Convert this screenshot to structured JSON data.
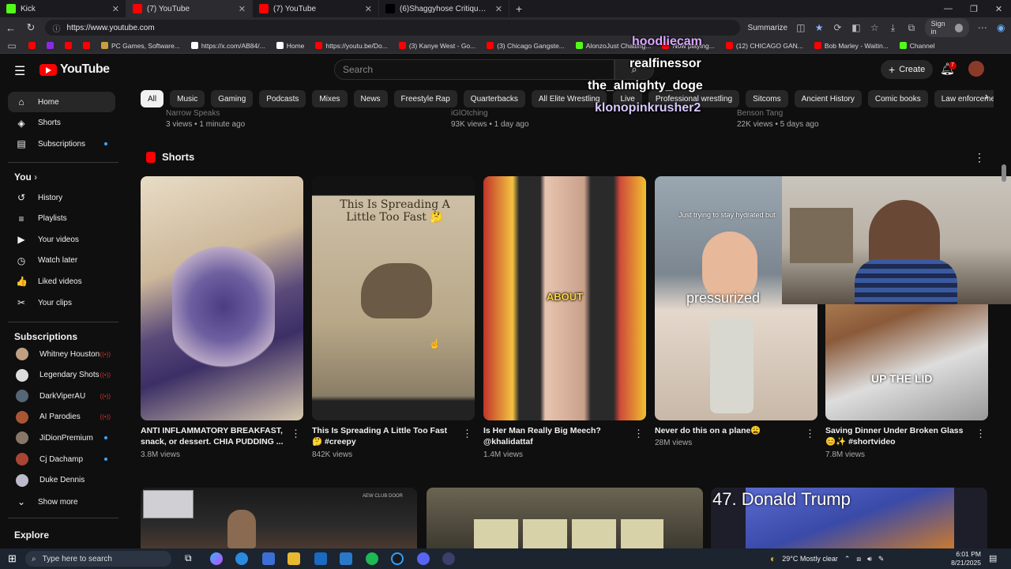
{
  "browser": {
    "tabs": [
      {
        "title": "Kick",
        "icon_color": "#53fc18",
        "active": false
      },
      {
        "title": "(7) YouTube",
        "icon_color": "#ff0000",
        "active": true
      },
      {
        "title": "(7) YouTube",
        "icon_color": "#ff0000",
        "active": false
      },
      {
        "title": "(6)Shaggyhose Critiques Kai Cenat",
        "icon_color": "#000000",
        "active": false
      }
    ],
    "new_tab": "+",
    "url": "https://www.youtube.com",
    "summarize": "Summarize",
    "sign_in": "Sign in",
    "bookmarks": [
      {
        "label": "",
        "color": "#ff0000"
      },
      {
        "label": "",
        "color": "#8a2be2"
      },
      {
        "label": "",
        "color": "#ff0000"
      },
      {
        "label": "",
        "color": "#ff0000"
      },
      {
        "label": "PC Games, Software...",
        "color": "#c8a040"
      },
      {
        "label": "https://x.com/AB84/...",
        "color": "#ffffff"
      },
      {
        "label": "Home",
        "color": "#ffffff"
      },
      {
        "label": "https://youtu.be/Do...",
        "color": "#ff0000"
      },
      {
        "label": "(3) Kanye West - Go...",
        "color": "#ff0000"
      },
      {
        "label": "(3) Chicago Gangste...",
        "color": "#ff0000"
      },
      {
        "label": "AlonzoJust Chatting...",
        "color": "#53fc18"
      },
      {
        "label": "Now playing...",
        "color": "#ff0000"
      },
      {
        "label": "(12) CHICAGO GAN...",
        "color": "#ff0000"
      },
      {
        "label": "Bob Marley - Waitin...",
        "color": "#ff0000"
      },
      {
        "label": "Channel",
        "color": "#53fc18"
      }
    ]
  },
  "masthead": {
    "logo_text": "YouTube",
    "search_placeholder": "Search",
    "create_label": "Create",
    "notification_count": "7"
  },
  "chips": [
    "All",
    "Music",
    "Gaming",
    "Podcasts",
    "Mixes",
    "News",
    "Freestyle Rap",
    "Quarterbacks",
    "All Elite Wrestling",
    "Live",
    "Professional wrestling",
    "Sitcoms",
    "Ancient History",
    "Comic books",
    "Law enforcement"
  ],
  "sidebar": {
    "main": [
      {
        "label": "Home",
        "icon": "home-icon",
        "glyph": "⌂"
      },
      {
        "label": "Shorts",
        "icon": "shorts-icon",
        "glyph": "◈"
      },
      {
        "label": "Subscriptions",
        "icon": "subscriptions-icon",
        "glyph": "▤"
      }
    ],
    "you_label": "You",
    "you": [
      {
        "label": "History",
        "icon": "history-icon",
        "glyph": "↺"
      },
      {
        "label": "Playlists",
        "icon": "playlists-icon",
        "glyph": "≡"
      },
      {
        "label": "Your videos",
        "icon": "your-videos-icon",
        "glyph": "▶"
      },
      {
        "label": "Watch later",
        "icon": "watch-later-icon",
        "glyph": "◷"
      },
      {
        "label": "Liked videos",
        "icon": "liked-videos-icon",
        "glyph": "👍"
      },
      {
        "label": "Your clips",
        "icon": "clips-icon",
        "glyph": "✂"
      }
    ],
    "subscriptions_label": "Subscriptions",
    "subscriptions": [
      {
        "label": "Whitney Houston",
        "color": "#c0a080",
        "status": "live"
      },
      {
        "label": "Legendary Shots",
        "color": "#dddddd",
        "status": "live"
      },
      {
        "label": "DarkViperAU",
        "color": "#556677",
        "status": "live"
      },
      {
        "label": "AI Parodies",
        "color": "#aa5533",
        "status": "live"
      },
      {
        "label": "JiDionPremium",
        "color": "#887766",
        "status": "dot"
      },
      {
        "label": "Cj Dachamp",
        "color": "#aa4433",
        "status": "dot"
      },
      {
        "label": "Duke Dennis",
        "color": "#bbbbcc",
        "status": ""
      }
    ],
    "show_more": "Show more",
    "explore_label": "Explore"
  },
  "prev_row": [
    {
      "channel": "Narrow Speaks",
      "meta": "3 views • 1 minute ago"
    },
    {
      "channel": "iGlOtching",
      "meta": "93K views • 1 day ago"
    },
    {
      "channel": "Benson Tang",
      "meta": "22K views • 5 days ago"
    }
  ],
  "shorts": {
    "section_title": "Shorts",
    "items": [
      {
        "title": "ANTI INFLAMMATORY BREAKFAST, snack, or dessert. CHIA PUDDING ...",
        "views": "3.8M views",
        "overlay": ""
      },
      {
        "title": "This Is Spreading A Little Too Fast 🤔 #creepy",
        "views": "842K views",
        "overlay": "This Is Spreading A Little Too Fast 🤔"
      },
      {
        "title": "Is Her Man Really Big Meech? @khalidattaf",
        "views": "1.4M views",
        "overlay": "ABOUT"
      },
      {
        "title": "Never do this on a plane😩",
        "views": "28M views",
        "overlay": "pressurized",
        "caption": "Just trying to stay hydrated but"
      },
      {
        "title": "Saving Dinner Under Broken Glass 😊✨ #shortvideo",
        "views": "7.8M views",
        "overlay": "UP THE LID"
      }
    ]
  },
  "lower_videos": [
    {
      "overlay": "AEW CLUB DOOR"
    },
    {
      "overlay": ""
    },
    {
      "overlay": "47. Donald Trump"
    }
  ],
  "stream_overlay": {
    "names": [
      "hoodliecam",
      "realfinessor",
      "the_almighty_doge",
      "klonopinkrusher2"
    ]
  },
  "taskbar": {
    "search_placeholder": "Type here to search",
    "weather": "29°C  Mostly clear",
    "time": "6:01 PM",
    "date": "8/21/2025"
  }
}
